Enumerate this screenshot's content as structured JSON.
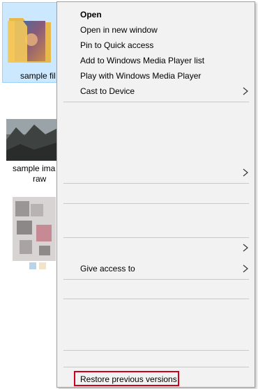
{
  "files": [
    {
      "label": "sample fil",
      "selected": true
    },
    {
      "label_line1": "sample ima",
      "label_line2": "raw"
    },
    {
      "label": ""
    }
  ],
  "menu": {
    "items": [
      {
        "label": "Open",
        "bold": true,
        "submenu": false
      },
      {
        "label": "Open in new window",
        "submenu": false
      },
      {
        "label": "Pin to Quick access",
        "submenu": false
      },
      {
        "label": "Add to Windows Media Player list",
        "submenu": false
      },
      {
        "label": "Play with Windows Media Player",
        "submenu": false
      },
      {
        "label": "Cast to Device",
        "submenu": true
      },
      {
        "label": "Give access to",
        "submenu": true
      },
      {
        "label": "Restore previous versions",
        "submenu": false,
        "highlighted": true
      }
    ]
  },
  "colors": {
    "menu_bg": "#f2f2f2",
    "selection_bg": "#cce8ff",
    "highlight_border": "#d0021b"
  }
}
